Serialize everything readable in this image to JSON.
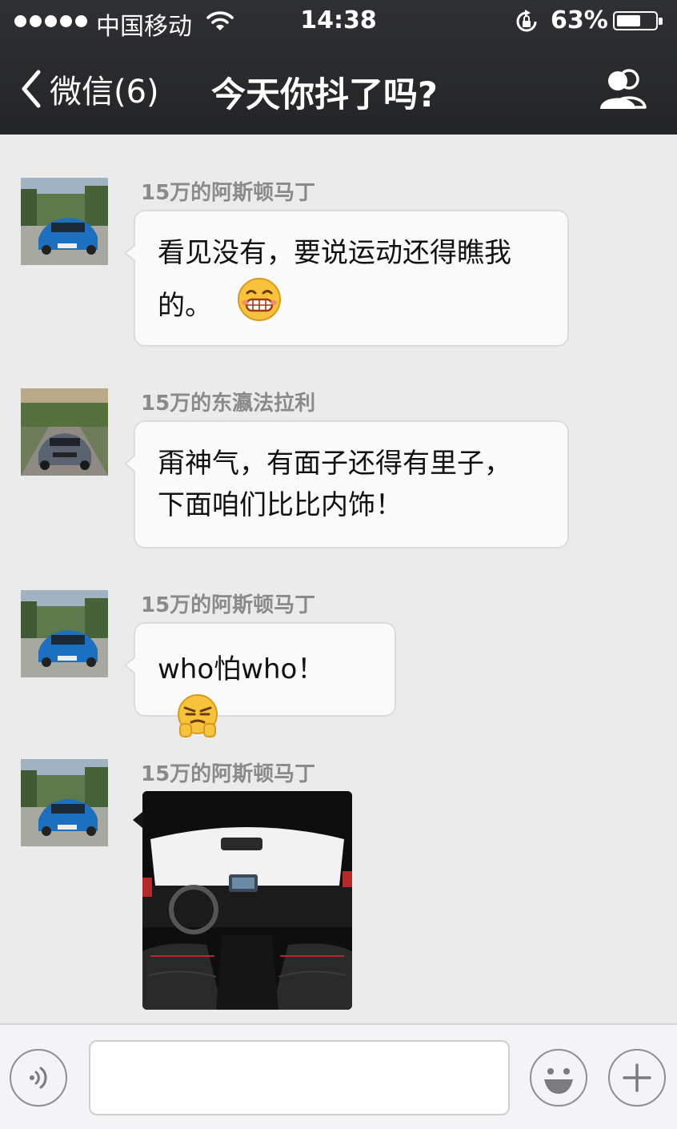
{
  "status_bar": {
    "carrier": "中国移动",
    "time": "14:38",
    "battery_percent": "63%",
    "battery_level": 0.63,
    "signal_bars": 5
  },
  "nav": {
    "back_label": "微信(6)",
    "title": "今天你抖了吗?"
  },
  "messages": [
    {
      "sender": "15万的阿斯顿马丁",
      "text_line1": "看见没有，要说运动还得瞧我",
      "text_line2": "的。",
      "emoji": "grinning-emoji",
      "avatar": "blue-car-avatar"
    },
    {
      "sender": "15万的东瀛法拉利",
      "text_line1": "甭神气，有面子还得有里子，",
      "text_line2": "下面咱们比比内饰！",
      "avatar": "gray-car-avatar"
    },
    {
      "sender": "15万的阿斯顿马丁",
      "text_line1": "who怕who！",
      "emoji": "smirk-emoji",
      "avatar": "blue-car-avatar"
    },
    {
      "sender": "15万的阿斯顿马丁",
      "image": "car-interior-photo",
      "avatar": "blue-car-avatar"
    }
  ],
  "input_bar": {
    "voice_icon": "voice-icon",
    "emoji_icon": "smiley-icon",
    "plus_icon": "plus-icon"
  },
  "colors": {
    "topbar": "#2a2b2e",
    "background": "#ebebeb",
    "bubble": "#fafafa",
    "sender": "#8a8a8a"
  }
}
